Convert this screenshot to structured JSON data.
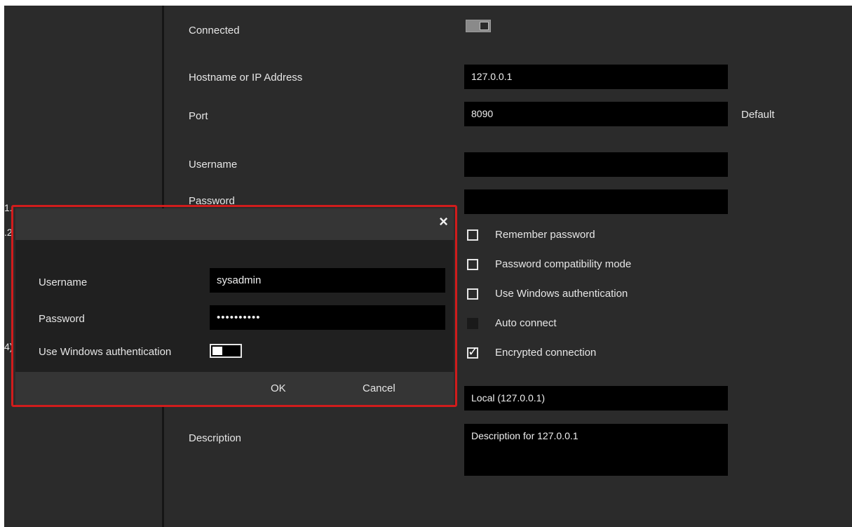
{
  "left_fragments": [
    "1.",
    ".2",
    "4)"
  ],
  "form": {
    "connected_label": "Connected",
    "connected_toggle": "on",
    "hostname_label": "Hostname or IP Address",
    "hostname_value": "127.0.0.1",
    "port_label": "Port",
    "port_value": "8090",
    "default_link": "Default",
    "username_label": "Username",
    "username_value": "",
    "password_label": "Password",
    "password_value": "",
    "checkboxes": [
      {
        "label": "Remember password",
        "checked": false
      },
      {
        "label": "Password compatibility mode",
        "checked": false
      },
      {
        "label": "Use Windows authentication",
        "checked": false
      },
      {
        "label": "Auto connect",
        "checked": false,
        "disabled": true
      },
      {
        "label": "Encrypted connection",
        "checked": true
      }
    ],
    "name_value": "Local (127.0.0.1)",
    "description_label": "Description",
    "description_value": "Description for  127.0.0.1"
  },
  "dialog": {
    "close_icon": "×",
    "username_label": "Username",
    "username_value": "sysadmin",
    "password_label": "Password",
    "password_value": "••••••••••",
    "windows_auth_label": "Use Windows authentication",
    "windows_auth_toggle": "off",
    "ok_label": "OK",
    "cancel_label": "Cancel",
    "highlight_color": "#d01c1c"
  }
}
